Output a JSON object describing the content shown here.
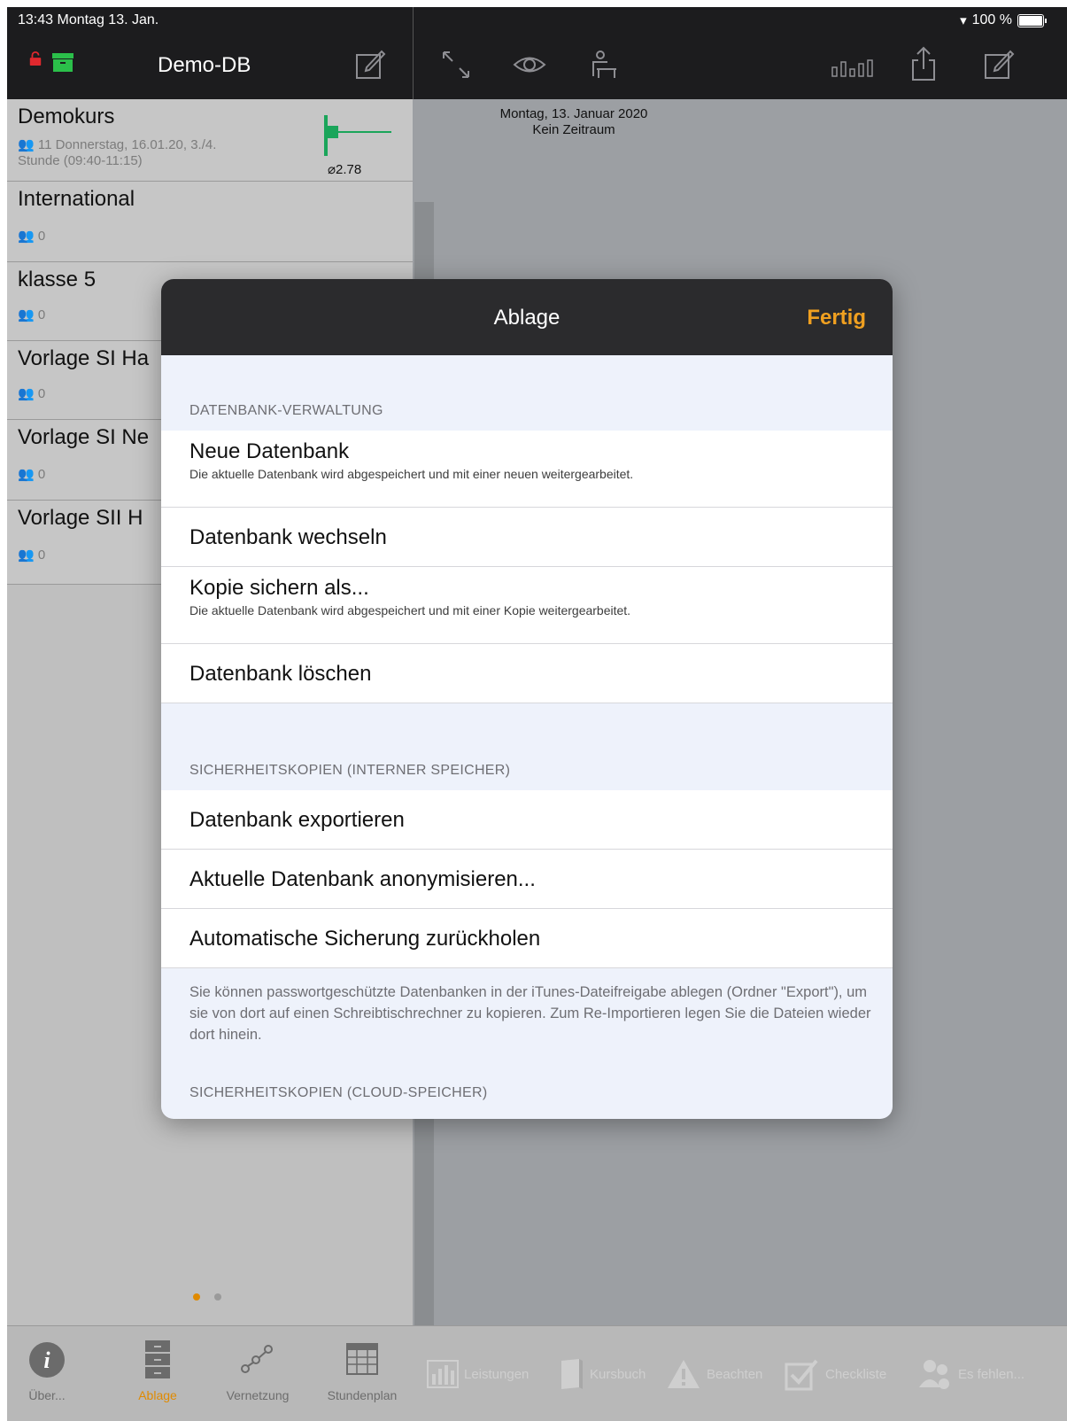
{
  "status": {
    "time": "13:43 Montag 13. Jan.",
    "battery": "100 %"
  },
  "nav": {
    "title": "Demo-DB"
  },
  "course_list": [
    {
      "title": "Demokurs",
      "sub_line1": "11  Donnerstag, 16.01.20, 3./4.",
      "sub_line2": "Stunde (09:40-11:15)",
      "avg": "⌀2.78"
    },
    {
      "title": "International",
      "sub_line1": "0"
    },
    {
      "title": "klasse 5",
      "sub_line1": "0"
    },
    {
      "title": "Vorlage SI Ha",
      "sub_line1": "0"
    },
    {
      "title": "Vorlage SI Ne",
      "sub_line1": "0"
    },
    {
      "title": "Vorlage SII H",
      "sub_line1": "0"
    }
  ],
  "detail": {
    "date": "Montag, 13. Januar 2020",
    "range": "Kein Zeitraum"
  },
  "modal": {
    "title": "Ablage",
    "done": "Fertig",
    "section1": "DATENBANK-VERWALTUNG",
    "rows1": [
      {
        "title": "Neue Datenbank",
        "sub": "Die aktuelle Datenbank wird abgespeichert und mit einer neuen weitergearbeitet."
      },
      {
        "title": "Datenbank wechseln"
      },
      {
        "title": "Kopie sichern als...",
        "sub": "Die aktuelle Datenbank wird abgespeichert und mit einer Kopie weitergearbeitet."
      },
      {
        "title": "Datenbank löschen"
      }
    ],
    "section2": "SICHERHEITSKOPIEN (INTERNER SPEICHER)",
    "rows2": [
      {
        "title": "Datenbank exportieren"
      },
      {
        "title": "Aktuelle Datenbank anonymisieren..."
      },
      {
        "title": "Automatische Sicherung zurückholen"
      }
    ],
    "footnote": "Sie können passwortgeschützte Datenbanken in der iTunes-Dateifreigabe ablegen (Ordner \"Export\"), um sie von dort auf einen Schreibtischrechner zu kopieren. Zum Re-Importieren legen Sie die Dateien wieder dort hinein.",
    "section3": "SICHERHEITSKOPIEN (CLOUD-SPEICHER)"
  },
  "tabs_left": [
    {
      "label": "Über...",
      "icon": "info-icon"
    },
    {
      "label": "Ablage",
      "icon": "cabinet-icon",
      "active": true
    },
    {
      "label": "Vernetzung",
      "icon": "network-icon"
    },
    {
      "label": "Stundenplan",
      "icon": "calendar-icon"
    }
  ],
  "tabs_right": [
    {
      "label": "Leistungen",
      "icon": "bar-chart-icon"
    },
    {
      "label": "Kursbuch",
      "icon": "book-icon"
    },
    {
      "label": "Beachten",
      "icon": "warning-icon"
    },
    {
      "label": "Checkliste",
      "icon": "checkbox-icon"
    },
    {
      "label": "Es fehlen...",
      "icon": "people-icon"
    }
  ],
  "colors": {
    "accent": "#e08a00",
    "done": "#f0a020",
    "chart": "#1aa55a"
  }
}
